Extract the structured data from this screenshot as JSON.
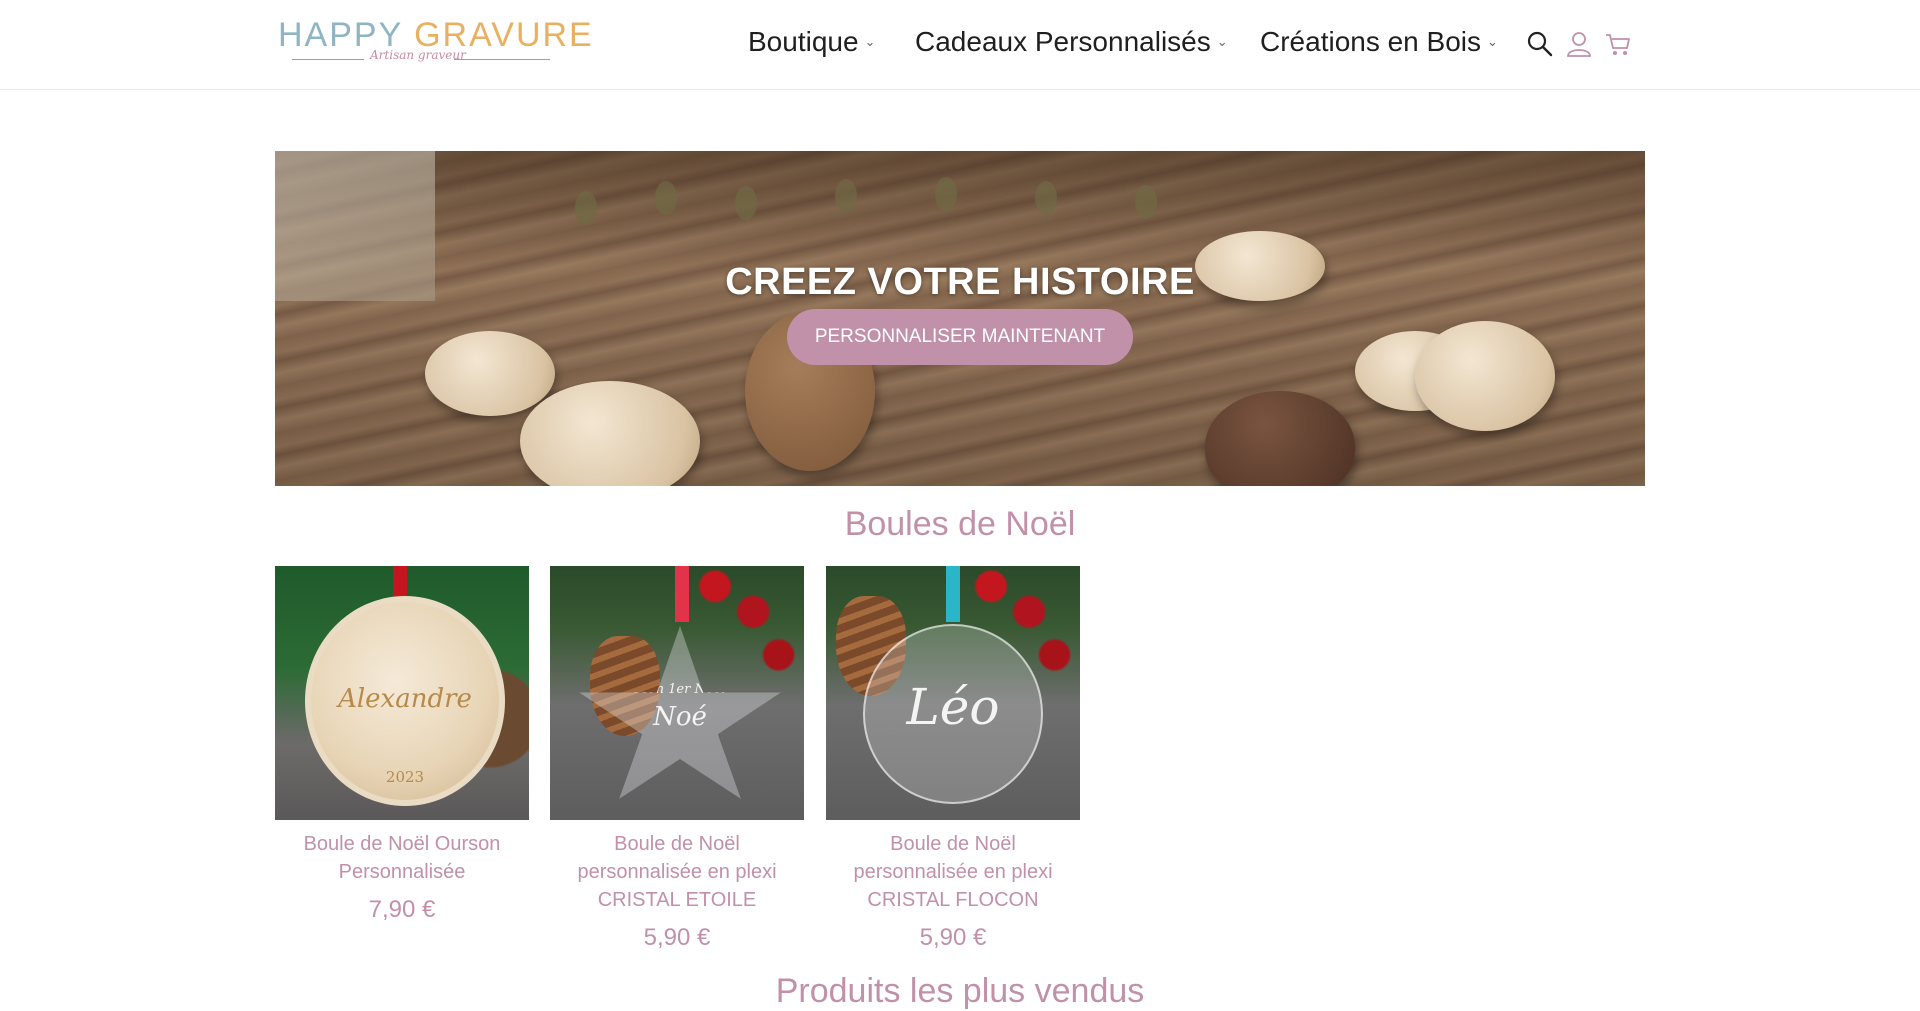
{
  "header": {
    "logo": {
      "word1": "HAPPY",
      "word2": "GRAVURE",
      "tagline": "Artisan graveur"
    },
    "nav": [
      {
        "label": "Boutique"
      },
      {
        "label": "Cadeaux Personnalisés"
      },
      {
        "label": "Créations en Bois"
      }
    ],
    "icons": [
      "search-icon",
      "user-icon",
      "cart-icon"
    ]
  },
  "hero": {
    "title": "CREEZ VOTRE HISTOIRE",
    "button": "PERSONNALISER MAINTENANT"
  },
  "section1": {
    "title": "Boules de Noël",
    "products": [
      {
        "name": "Boule de Noël Ourson Personnalisée",
        "price": "7,90 €",
        "image_text": "Alexandre",
        "image_year": "2023"
      },
      {
        "name": "Boule de Noël personnalisée en plexi CRISTAL ETOILE",
        "price": "5,90 €",
        "image_text": "Noé",
        "image_subtext": "Mon 1er Noël"
      },
      {
        "name": "Boule de Noël personnalisée en plexi CRISTAL FLOCON",
        "price": "5,90 €",
        "image_text": "Léo"
      }
    ]
  },
  "section2": {
    "title": "Produits les plus vendus"
  },
  "colors": {
    "accent": "#c191a9",
    "logo_blue": "#8fb4c4",
    "logo_orange": "#e9b060"
  }
}
